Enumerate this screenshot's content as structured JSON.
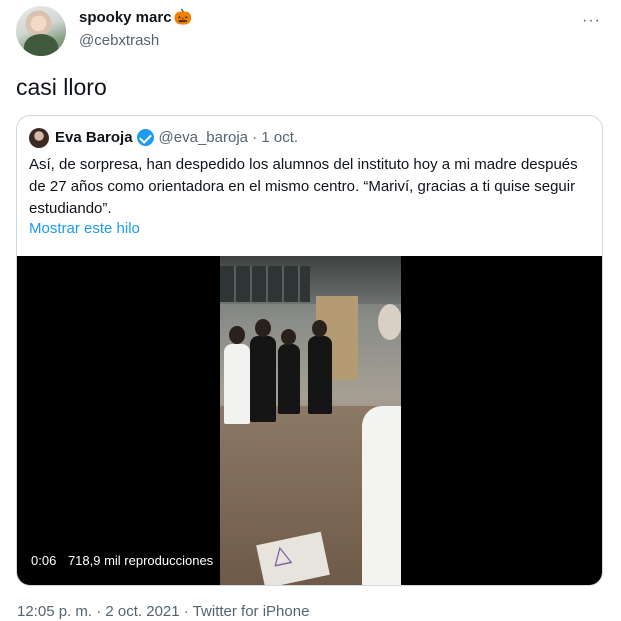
{
  "author": {
    "display_name": "spooky marc",
    "emoji": "🎃",
    "handle": "@cebxtrash"
  },
  "tweet": {
    "text": "casi lloro",
    "more_icon": "···"
  },
  "quoted_tweet": {
    "name": "Eva Baroja",
    "handle": "@eva_baroja",
    "separator": "·",
    "date": "1 oct.",
    "body": "Así, de sorpresa, han despedido los alumnos del instituto hoy a mi madre después de 27 años como orientadora en el mismo centro. “Mariví, gracias a ti quise seguir estudiando”.",
    "show_thread": "Mostrar este hilo",
    "video": {
      "elapsed": "0:06",
      "views": "718,9 mil reproducciones"
    }
  },
  "footer": {
    "time": "12:05 p. m.",
    "date": "2 oct. 2021",
    "source": "Twitter for iPhone",
    "separator": "·"
  },
  "colors": {
    "link": "#1d9bf0",
    "secondary_text": "#536471",
    "border": "#cfd9de",
    "verified": "#1d9bf0"
  }
}
